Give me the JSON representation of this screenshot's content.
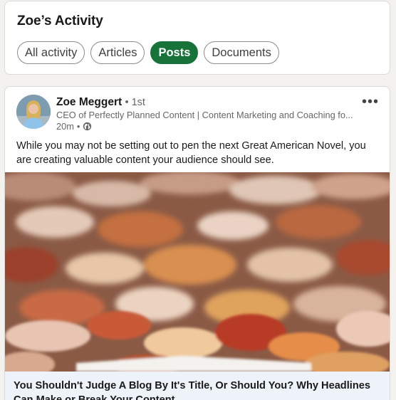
{
  "activity": {
    "title": "Zoe’s Activity",
    "filters": [
      {
        "label": "All activity",
        "active": false
      },
      {
        "label": "Articles",
        "active": false
      },
      {
        "label": "Posts",
        "active": true
      },
      {
        "label": "Documents",
        "active": false
      }
    ]
  },
  "post": {
    "author": "Zoe Meggert",
    "degree": "1st",
    "headline": "CEO of Perfectly Planned Content | Content Marketing and Coaching fo...",
    "time": "20m",
    "visibility_icon": "globe-icon",
    "more_icon": "more-options-icon",
    "text": "While you may not be setting out to pen the next Great American Novel, you are creating valuable content your audience should see.",
    "article_title": "You Shouldn't Judge A Blog By It's Title, Or Should You? Why Headlines Can Make or Break Your Content"
  },
  "colors": {
    "accent": "#18733a",
    "page_bg": "#f3f2ef",
    "link_preview_bg": "#edf3f8"
  }
}
